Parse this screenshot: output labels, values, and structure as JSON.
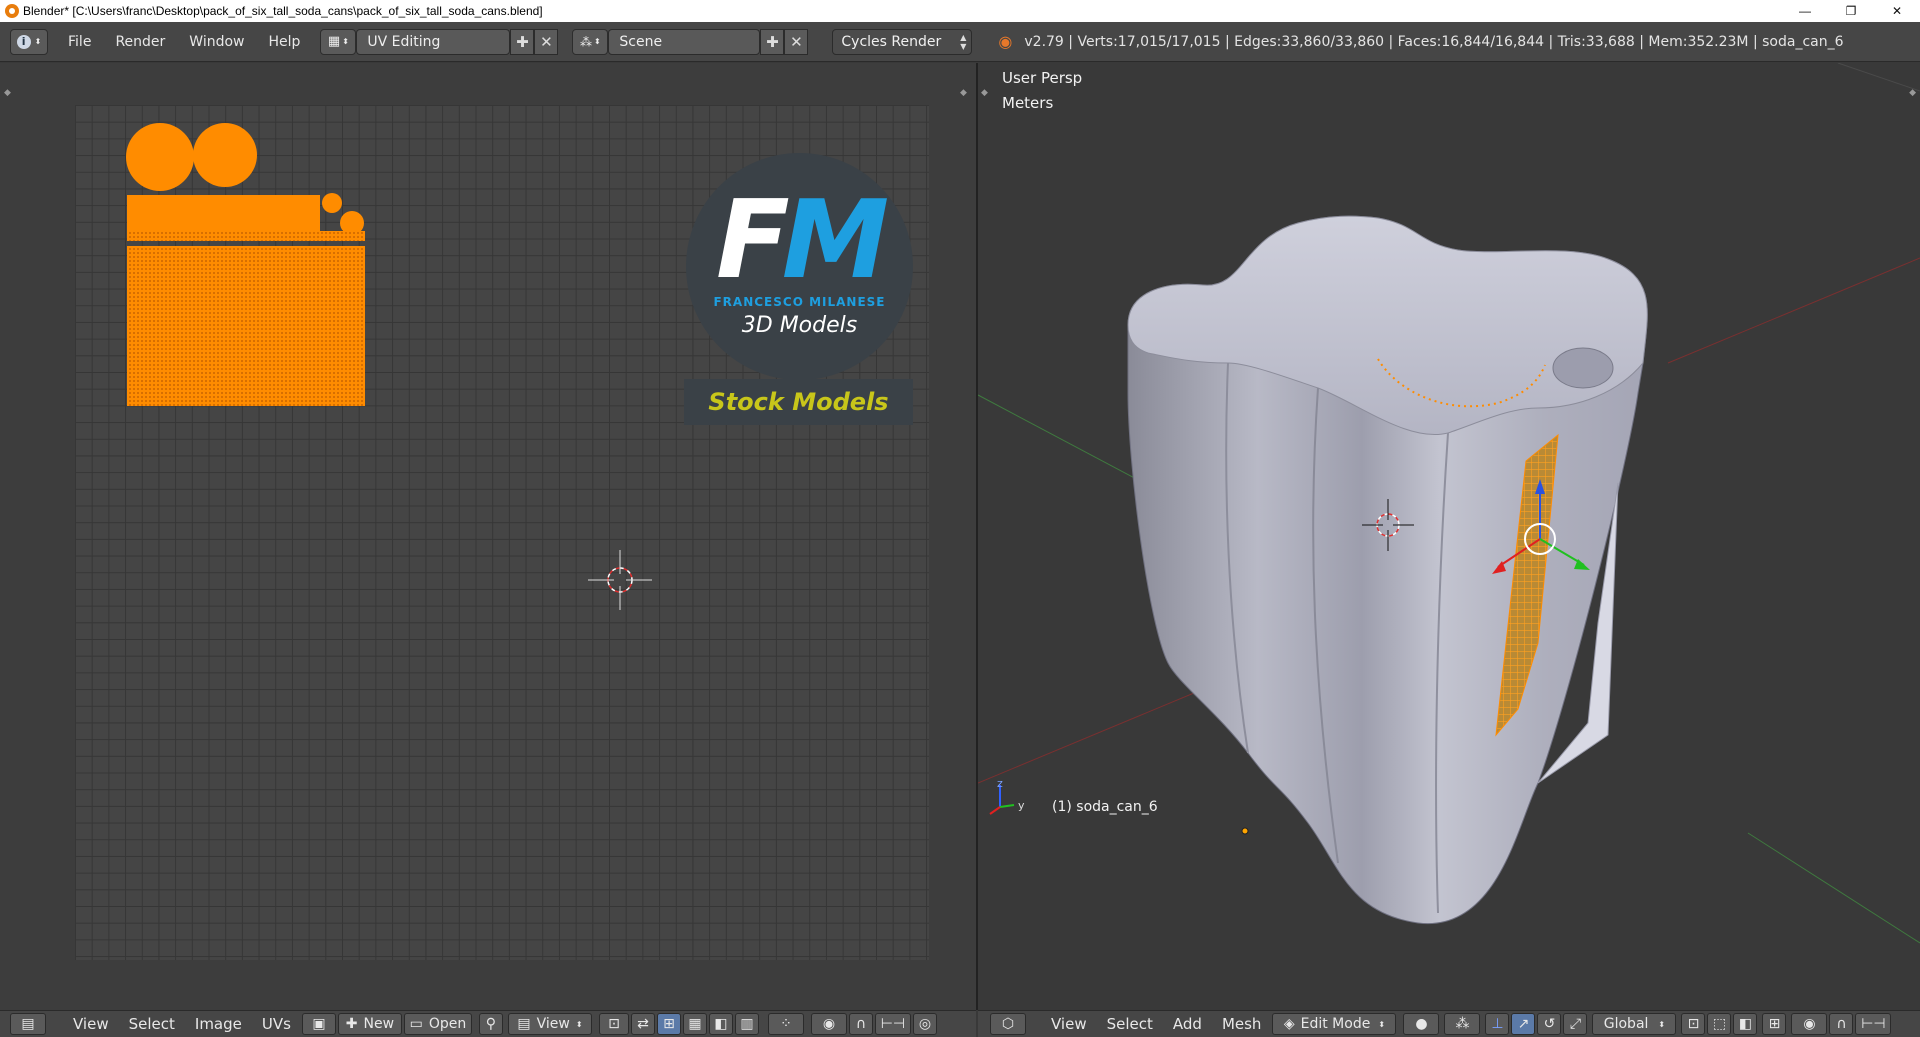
{
  "window": {
    "title": "Blender* [C:\\Users\\franc\\Desktop\\pack_of_six_tall_soda_cans\\pack_of_six_tall_soda_cans.blend]",
    "minimize": "—",
    "maximize": "❐",
    "close": "✕"
  },
  "menu": [
    "File",
    "Render",
    "Window",
    "Help"
  ],
  "layout": {
    "value": "UV Editing"
  },
  "scene": {
    "value": "Scene"
  },
  "engine": {
    "value": "Cycles Render"
  },
  "stats": "v2.79 | Verts:17,015/17,015 | Edges:33,860/33,860 | Faces:16,844/16,844 | Tris:33,688 | Mem:352.23M | soda_can_6",
  "uv_editor": {
    "logo_letters_f": "F",
    "logo_letters_m": "M",
    "logo_name": "FRANCESCO MILANESE",
    "logo_sub": "3D Models",
    "stock": "Stock Models",
    "bottom": {
      "view": "View",
      "select": "Select",
      "image": "Image",
      "uvs": "UVs",
      "new": "New",
      "open": "Open",
      "view2": "View"
    }
  },
  "viewport": {
    "persp": "User Persp",
    "units": "Meters",
    "object": "(1) soda_can_6",
    "axis_y": "y",
    "axis_z": "z",
    "bottom": {
      "view": "View",
      "select": "Select",
      "add": "Add",
      "mesh": "Mesh",
      "mode": "Edit Mode",
      "orientation": "Global"
    }
  },
  "colors": {
    "selection": "#ff8c00",
    "header": "#464646",
    "fm_blue": "#1e9fe0",
    "stock_yellow": "#c8c61a"
  }
}
